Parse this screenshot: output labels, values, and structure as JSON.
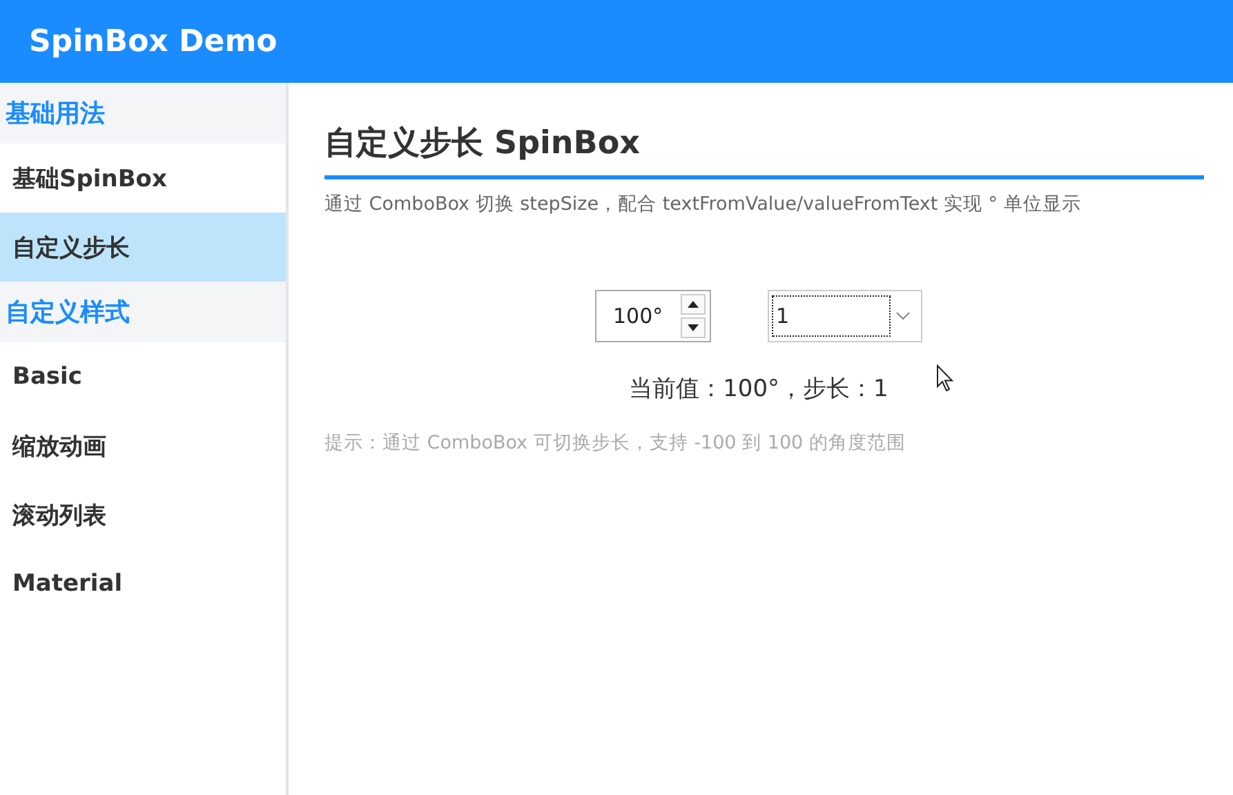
{
  "app_bar": {
    "title": "SpinBox Demo"
  },
  "sidebar": {
    "sections": [
      {
        "title": "基础用法",
        "items": [
          {
            "label": "基础SpinBox",
            "selected": false
          },
          {
            "label": "自定义步长",
            "selected": true
          }
        ]
      },
      {
        "title": "自定义样式",
        "items": [
          {
            "label": "Basic",
            "selected": false
          },
          {
            "label": "缩放动画",
            "selected": false
          },
          {
            "label": "滚动列表",
            "selected": false
          },
          {
            "label": "Material",
            "selected": false
          }
        ]
      }
    ]
  },
  "page": {
    "title": "自定义步长 SpinBox",
    "description": "通过 ComboBox 切换 stepSize，配合 textFromValue/valueFromText 实现 ° 单位显示",
    "spinbox": {
      "value": "100°"
    },
    "combobox": {
      "value": "1",
      "focused": true
    },
    "current_value": "当前值：100°，步长：1",
    "hint": "提示：通过 ComboBox 可切换步长，支持 -100 到 100 的角度范围"
  }
}
